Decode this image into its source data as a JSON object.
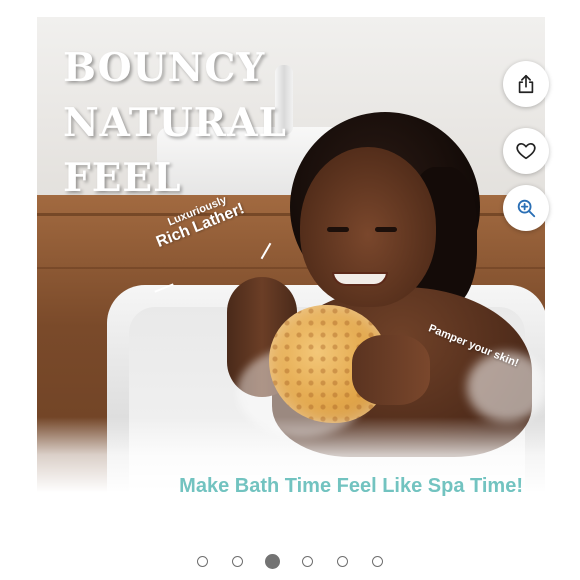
{
  "product_image": {
    "headline": [
      "BOUNCY",
      "NATURAL",
      "FEEL"
    ],
    "callouts": {
      "rich_small": "Luxuriously",
      "rich_big": "Rich Lather!",
      "pamper": "Pamper your skin!"
    },
    "tagline": "Make Bath Time Feel Like Spa Time!",
    "colors": {
      "tagline": "#72c3c0",
      "headline": "#ffffff"
    }
  },
  "actions": [
    {
      "name": "share",
      "icon": "share-icon"
    },
    {
      "name": "favorite",
      "icon": "heart-icon"
    },
    {
      "name": "zoom",
      "icon": "zoom-in-icon",
      "color": "#2a6fb5"
    }
  ],
  "carousel": {
    "total": 6,
    "active_index": 3
  }
}
